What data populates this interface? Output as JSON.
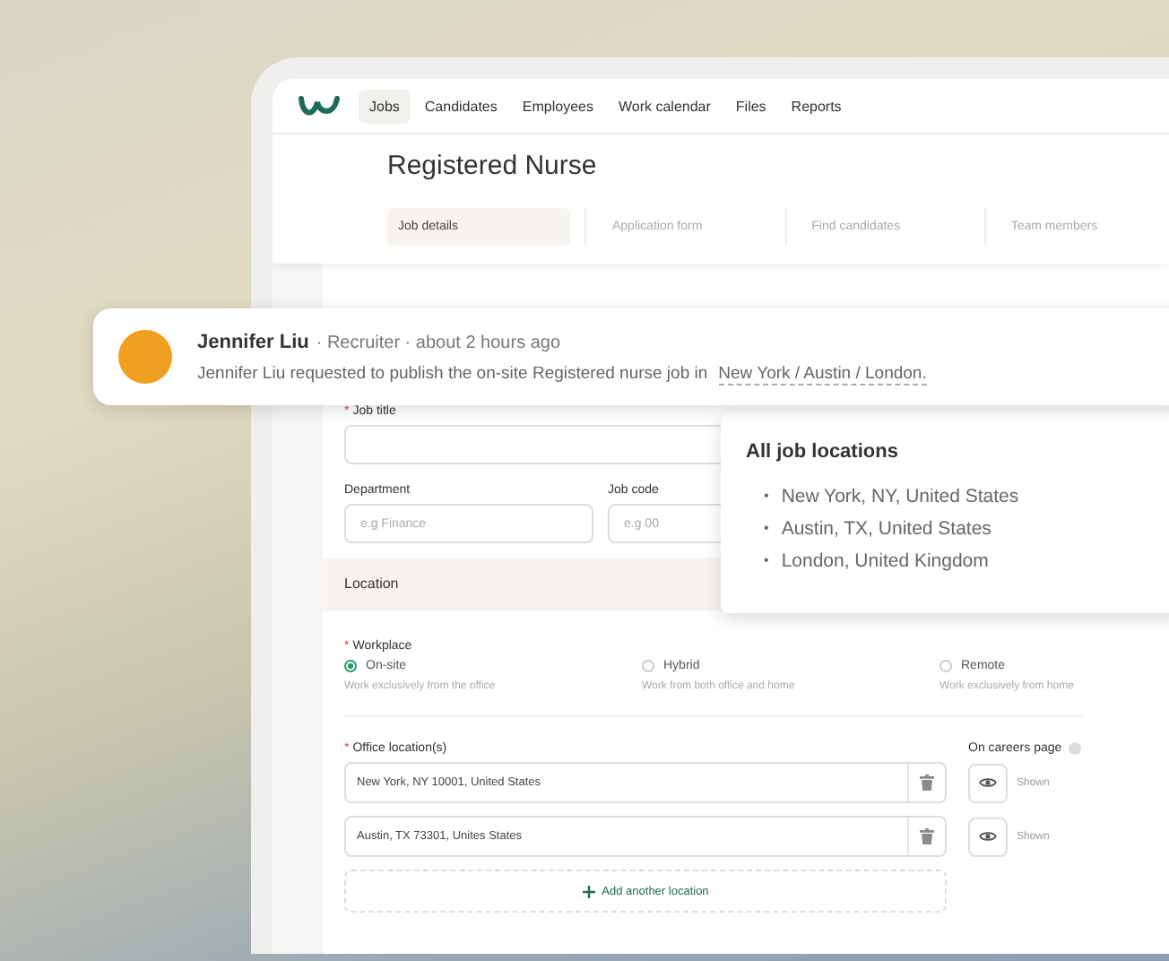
{
  "nav": {
    "items": [
      {
        "label": "Jobs",
        "selected": true
      },
      {
        "label": "Candidates",
        "selected": false
      },
      {
        "label": "Employees",
        "selected": false
      },
      {
        "label": "Work calendar",
        "selected": false
      },
      {
        "label": "Files",
        "selected": false
      },
      {
        "label": "Reports",
        "selected": false
      }
    ]
  },
  "page": {
    "title": "Registered Nurse",
    "tabs": [
      {
        "label": "Job details",
        "selected": true
      },
      {
        "label": "Application form",
        "selected": false
      },
      {
        "label": "Find candidates",
        "selected": false
      },
      {
        "label": "Team members",
        "selected": false
      }
    ]
  },
  "form": {
    "job_title": {
      "required_mark": "*",
      "label": "Job title"
    },
    "department": {
      "label": "Department",
      "placeholder": "e.g Finance"
    },
    "job_code": {
      "label": "Job code",
      "placeholder": "e.g 00"
    },
    "location_section": {
      "title": "Location"
    },
    "workplace": {
      "required_mark": "*",
      "label": "Workplace",
      "options": [
        {
          "label": "On-site",
          "description": "Work exclusively from the office",
          "selected": true
        },
        {
          "label": "Hybrid",
          "description": "Work from both office and home",
          "selected": false
        },
        {
          "label": "Remote",
          "description": "Work exclusively from home",
          "selected": false
        }
      ]
    },
    "office_locations": {
      "required_mark": "*",
      "label": "Office location(s)",
      "careers_label": "On careers page",
      "items": [
        {
          "value": "New York, NY 10001, United States",
          "visibility": "Shown"
        },
        {
          "value": "Austin, TX 73301, Unites States",
          "visibility": "Shown"
        }
      ],
      "add_button": "Add another location"
    }
  },
  "notification": {
    "name": "Jennifer Liu",
    "meta": "· Recruiter · about 2 hours ago",
    "message": "Jennifer Liu requested to publish the on-site Registered nurse job in",
    "link": "New York / Austin / London."
  },
  "popover": {
    "title": "All job locations",
    "items": [
      {
        "marker": "•",
        "text": "New York, NY, United States"
      },
      {
        "marker": "•",
        "text": "Austin, TX, United States"
      },
      {
        "marker": "•",
        "text": "London, United Kingdom"
      }
    ]
  }
}
